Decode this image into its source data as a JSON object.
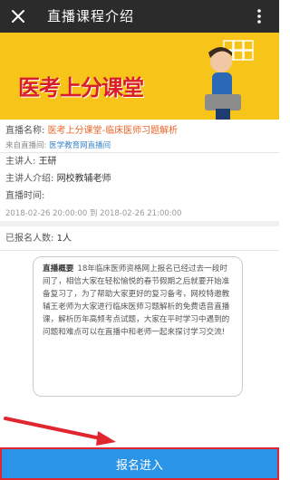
{
  "header": {
    "title": "直播课程介绍"
  },
  "banner": {
    "brand_text": "医考上分课堂"
  },
  "info": {
    "course_label": "直播名称:",
    "course_name": "医考上分课堂-临床医师习题解析",
    "room_label": "来自直播间:",
    "room_name": "医学教育网直播间",
    "host_label": "主讲人:",
    "host_name": "王研",
    "host_intro_label": "主讲人介绍:",
    "host_intro": "网校教辅老师",
    "time_label": "直播时间:",
    "time_range": "2018-02-26 20:00:00 到 2018-02-26 21:00:00",
    "enrolled_label": "已报名人数:",
    "enrolled_count": "1人"
  },
  "description": {
    "tag": "直播概要",
    "text": "18年临床医师资格网上报名已经过去一段时间了，相信大家在轻松愉悦的春节假期之后就要开始准备复习了，为了帮助大家更好的复习备考，网校特邀教辅王老师为大家进行临床医师习题解析的免费语音直播课，解析历年高频考点试题，大家在平时学习中遇到的问题和难点可以在直播中和老师一起来探讨学习交流!"
  },
  "cta": {
    "label": "报名进入"
  },
  "colors": {
    "accent": "#2a95e8",
    "highlight": "#e8652a",
    "banner": "#f7c41a",
    "annotation": "#e0262e"
  }
}
